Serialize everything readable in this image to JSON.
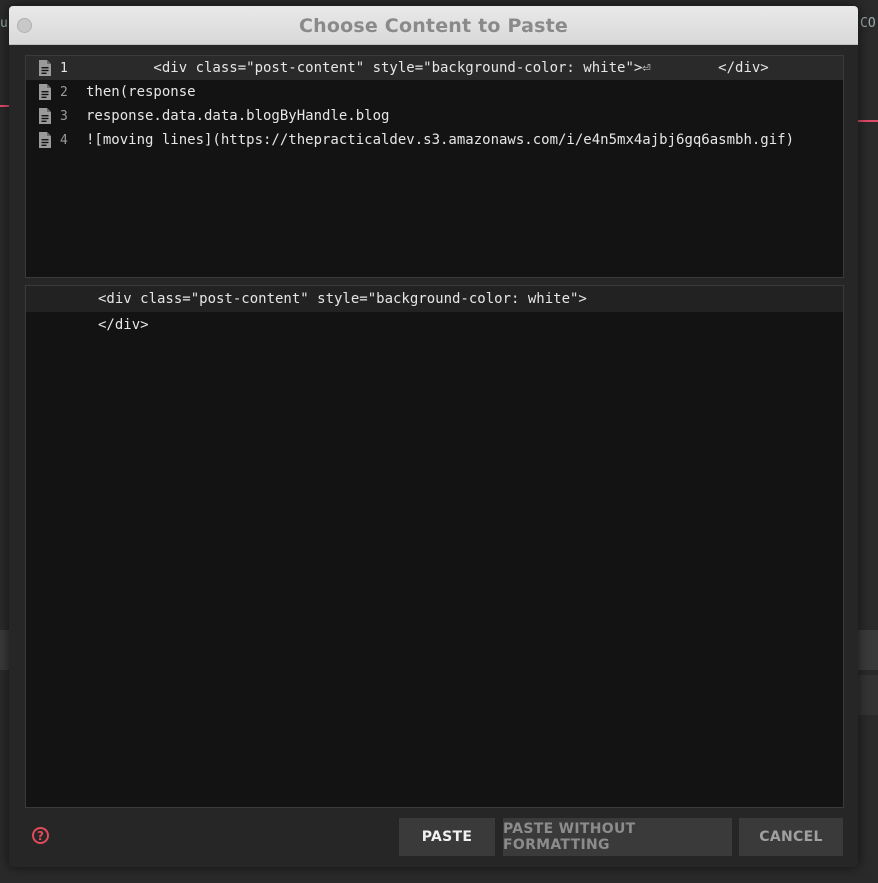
{
  "dialog": {
    "title": "Choose Content to Paste"
  },
  "clipboard_items": [
    {
      "number": "1",
      "text": "        <div class=\"post-content\" style=\"background-color: white\">⏎        </div>",
      "selected": true
    },
    {
      "number": "2",
      "text": "then(response",
      "selected": false
    },
    {
      "number": "3",
      "text": "response.data.data.blogByHandle.blog",
      "selected": false
    },
    {
      "number": "4",
      "text": "![moving lines](https://thepracticaldev.s3.amazonaws.com/i/e4n5mx4ajbj6gq6asmbh.gif)",
      "selected": false
    }
  ],
  "preview": {
    "lines": [
      "<div class=\"post-content\" style=\"background-color: white\">",
      "</div>"
    ]
  },
  "buttons": {
    "paste": "PASTE",
    "paste_plain": "PASTE WITHOUT FORMATTING",
    "cancel": "CANCEL"
  },
  "help_icon": "?",
  "icons": {
    "item": "document-icon",
    "help": "help-icon"
  },
  "colors": {
    "accent": "#e04a5a",
    "panel_bg": "#131313",
    "selected_row": "#2a2a2a"
  }
}
